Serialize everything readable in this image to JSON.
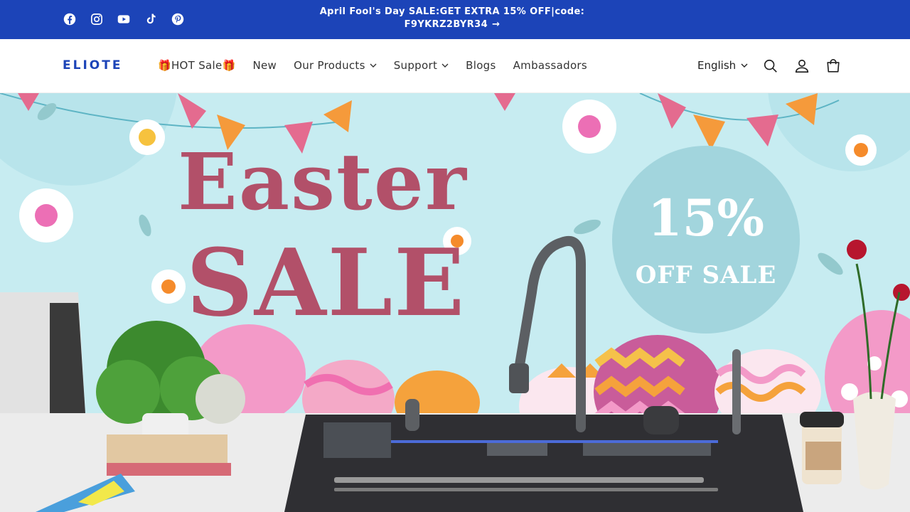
{
  "announcement": {
    "text_line1": "April Fool's Day SALE:GET EXTRA 15% OFF|code:",
    "text_line2": "F9YKRZ2BYR34",
    "arrow": "→",
    "social": [
      "facebook-icon",
      "instagram-icon",
      "youtube-icon",
      "tiktok-icon",
      "pinterest-icon"
    ]
  },
  "header": {
    "logo": "ELIOTE",
    "nav": [
      {
        "label": "🎁HOT Sale🎁",
        "dropdown": false
      },
      {
        "label": "New",
        "dropdown": false
      },
      {
        "label": "Our Products",
        "dropdown": true
      },
      {
        "label": "Support",
        "dropdown": true
      },
      {
        "label": "Blogs",
        "dropdown": false
      },
      {
        "label": "Ambassadors",
        "dropdown": false
      }
    ],
    "language": "English",
    "icons": [
      "search-icon",
      "account-icon",
      "cart-icon"
    ]
  },
  "hero": {
    "title_line1": "Easter",
    "title_line2": "SALE",
    "badge_percent": "15%",
    "badge_text": "OFF SALE",
    "colors": {
      "background": "#c7ecf1",
      "title": "#b25069",
      "badge": "#a2d5dd",
      "brand": "#1c44b8"
    }
  }
}
